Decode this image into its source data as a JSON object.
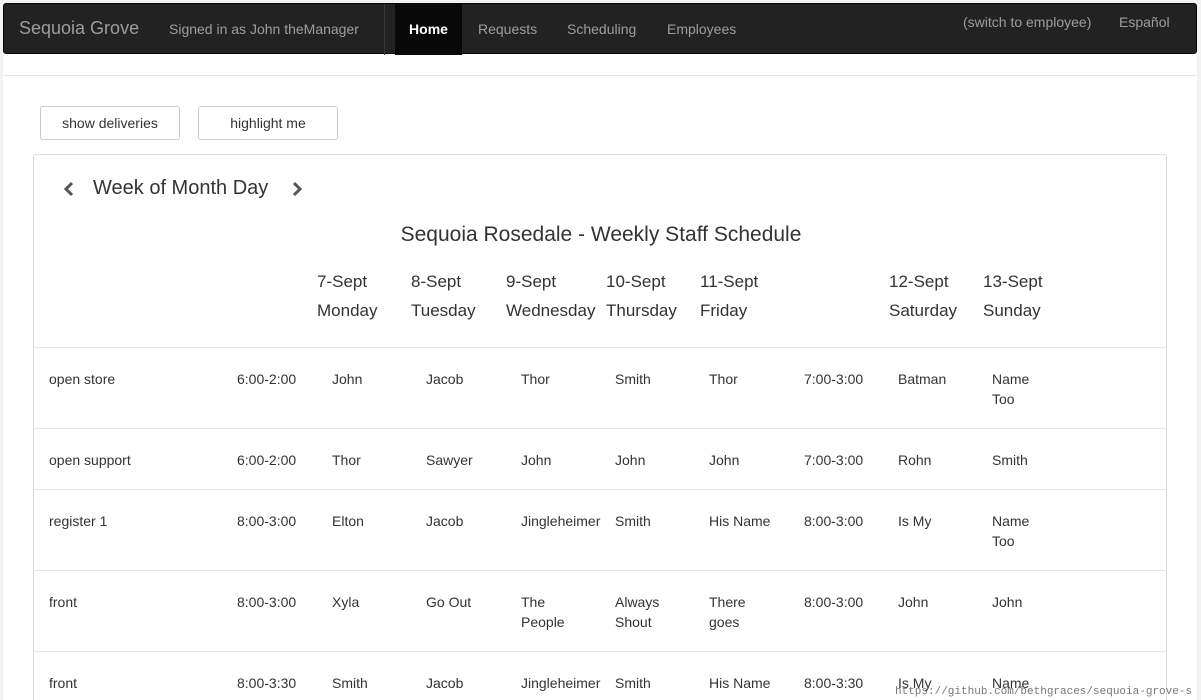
{
  "nav": {
    "brand": "Sequoia Grove",
    "signed_in": "Signed in as John theManager",
    "items": [
      {
        "label": "Home",
        "active": true
      },
      {
        "label": "Requests",
        "active": false
      },
      {
        "label": "Scheduling",
        "active": false
      },
      {
        "label": "Employees",
        "active": false
      }
    ],
    "switch": "(switch to employee)",
    "language": "Español"
  },
  "buttons": {
    "deliveries": "show deliveries",
    "highlight": "highlight me"
  },
  "schedule": {
    "week_label": "Week of Month Day",
    "title": "Sequoia Rosedale - Weekly Staff Schedule",
    "days": [
      {
        "date": "7-Sept",
        "day": "Monday"
      },
      {
        "date": "8-Sept",
        "day": "Tuesday"
      },
      {
        "date": "9-Sept",
        "day": "Wednesday"
      },
      {
        "date": "10-Sept",
        "day": "Thursday"
      },
      {
        "date": "11-Sept",
        "day": "Friday"
      },
      {
        "date": "12-Sept",
        "day": "Saturday"
      },
      {
        "date": "13-Sept",
        "day": "Sunday"
      }
    ],
    "rows": [
      {
        "position": "open store",
        "weekday_time": "6:00-2:00",
        "mon": "John",
        "tue": "Jacob",
        "wed": "Thor",
        "thu": "Smith",
        "fri": "Thor",
        "weekend_time": "7:00-3:00",
        "sat": "Batman",
        "sun": "Name Too"
      },
      {
        "position": "open support",
        "weekday_time": "6:00-2:00",
        "mon": "Thor",
        "tue": "Sawyer",
        "wed": "John",
        "thu": "John",
        "fri": "John",
        "weekend_time": "7:00-3:00",
        "sat": "Rohn",
        "sun": "Smith"
      },
      {
        "position": "register 1",
        "weekday_time": "8:00-3:00",
        "mon": "Elton",
        "tue": "Jacob",
        "wed": "Jingleheimer",
        "thu": "Smith",
        "fri": "His Name",
        "weekend_time": "8:00-3:00",
        "sat": "Is My",
        "sun": "Name Too"
      },
      {
        "position": "front",
        "weekday_time": "8:00-3:00",
        "mon": "Xyla",
        "tue": "Go Out",
        "wed": "The People",
        "thu": "Always Shout",
        "fri": "There goes",
        "weekend_time": "8:00-3:00",
        "sat": "John",
        "sun": "John"
      },
      {
        "position": "front",
        "weekday_time": "8:00-3:30",
        "mon": "Smith",
        "tue": "Jacob",
        "wed": "Jingleheimer",
        "thu": "Smith",
        "fri": "His Name",
        "weekend_time": "8:00-3:30",
        "sat": "Is My",
        "sun": "Name"
      }
    ]
  },
  "status_url": "https://github.com/bethgraces/sequoia-grove-s"
}
